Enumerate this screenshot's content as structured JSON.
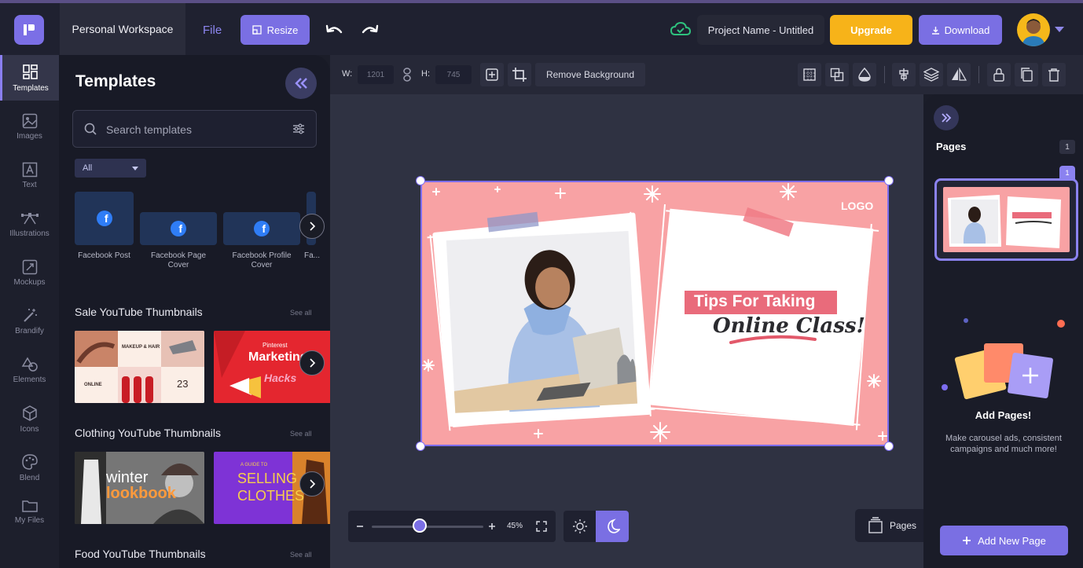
{
  "topbar": {
    "workspace": "Personal Workspace",
    "file_menu": "File",
    "resize_label": "Resize",
    "project_name": "Project Name - Untitled",
    "upgrade_label": "Upgrade",
    "download_label": "Download"
  },
  "sidebar": {
    "items": [
      {
        "label": "Templates",
        "icon": "templates-icon"
      },
      {
        "label": "Images",
        "icon": "image-icon"
      },
      {
        "label": "Text",
        "icon": "text-icon"
      },
      {
        "label": "Illustrations",
        "icon": "illustrations-icon"
      },
      {
        "label": "Mockups",
        "icon": "mockups-icon"
      },
      {
        "label": "Brandify",
        "icon": "magic-wand-icon"
      },
      {
        "label": "Elements",
        "icon": "shapes-icon"
      },
      {
        "label": "Icons",
        "icon": "cube-icon"
      },
      {
        "label": "Blend",
        "icon": "palette-icon"
      },
      {
        "label": "My Files",
        "icon": "folder-icon"
      }
    ]
  },
  "templates_panel": {
    "title": "Templates",
    "search_placeholder": "Search templates",
    "category_filter": "All",
    "facebook_templates": [
      {
        "label": "Facebook Post"
      },
      {
        "label": "Facebook Page Cover"
      },
      {
        "label": "Facebook Profile Cover"
      },
      {
        "label": "Fa..."
      }
    ],
    "sections": [
      {
        "title": "Sale YouTube Thumbnails",
        "see_all": "See all",
        "thumbs": [
          {
            "text_1": "MAKEUP & HAIR",
            "text_2": "ONLINE",
            "text_3": "23"
          },
          {
            "text_1": "Pinterest",
            "text_2": "Marketing",
            "text_3": "Hacks"
          }
        ]
      },
      {
        "title": "Clothing YouTube Thumbnails",
        "see_all": "See all",
        "thumbs": [
          {
            "text_1": "winter",
            "text_2": "lookbook"
          },
          {
            "text_1": "A GUIDE TO",
            "text_2": "SELLING",
            "text_3": "CLOTHES"
          }
        ]
      },
      {
        "title": "Food YouTube Thumbnails",
        "see_all": "See all"
      }
    ]
  },
  "toolbar": {
    "width_label": "W:",
    "width_value": "1201",
    "height_label": "H:",
    "height_value": "745",
    "remove_background": "Remove Background"
  },
  "design": {
    "logo_text": "LOGO",
    "headline_1": "Tips For Taking",
    "headline_2": "Online Class!"
  },
  "canvas_controls": {
    "zoom_value": "45%",
    "zoom_fraction": 0.45,
    "pages_toggle": "Pages"
  },
  "pages_panel": {
    "title": "Pages",
    "count": "1",
    "page_number": "1",
    "add_title": "Add Pages!",
    "add_description": "Make carousel ads, consistent campaigns and much more!",
    "add_button": "Add New Page"
  },
  "colors": {
    "accent": "#7a6fe3",
    "upgrade": "#f7b319",
    "design_background": "#f8a2a4",
    "headline_highlight": "#e96b7b"
  }
}
